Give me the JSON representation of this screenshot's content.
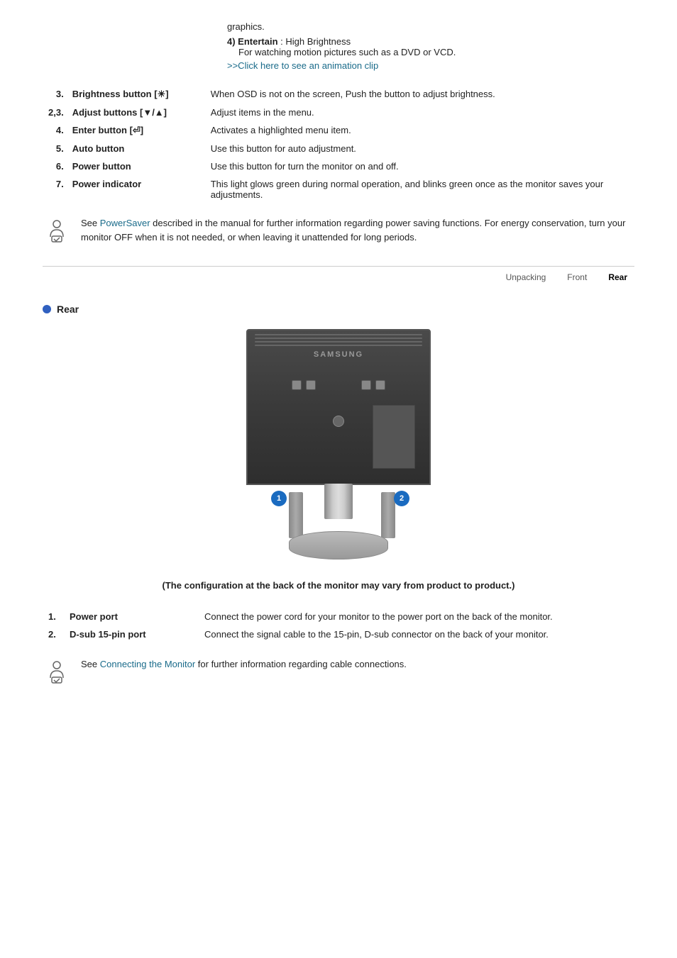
{
  "top": {
    "intro_text": "graphics.",
    "entertain": {
      "label": "4) Entertain",
      "colon": " : High Brightness",
      "sub": "For watching motion pictures such as a DVD or VCD.",
      "link_text": ">>Click here to see an animation clip",
      "link_href": "#"
    }
  },
  "features": [
    {
      "num": "3.",
      "label": "Brightness button [☀]",
      "desc": "When OSD is not on the screen, Push the button to adjust brightness."
    },
    {
      "num": "2,3.",
      "label": "Adjust buttons [▼/▲]",
      "desc": "Adjust items in the menu."
    },
    {
      "num": "4.",
      "label": "Enter button [⏎]",
      "desc": "Activates a highlighted menu item."
    },
    {
      "num": "5.",
      "label": "Auto button",
      "desc": "Use this button for auto adjustment."
    },
    {
      "num": "6.",
      "label": "Power button",
      "desc": "Use this button for turn the monitor on and off."
    },
    {
      "num": "7.",
      "label": "Power indicator",
      "desc": "This light glows green during normal operation, and blinks green once as the monitor saves your adjustments."
    }
  ],
  "note1": {
    "text_before": "See ",
    "link_text": "PowerSaver",
    "link_href": "#",
    "text_after": " described in the manual for further information regarding power saving functions. For energy conservation, turn your monitor OFF when it is not needed, or when leaving it unattended for long periods."
  },
  "nav": {
    "items": [
      {
        "label": "Unpacking",
        "active": false
      },
      {
        "label": "Front",
        "active": false
      },
      {
        "label": "Rear",
        "active": true
      }
    ]
  },
  "rear_section": {
    "title": "Rear",
    "config_note": "(The configuration at the back of the monitor may vary from product to product.)"
  },
  "rear_features": [
    {
      "num": "1.",
      "label": "Power port",
      "desc": "Connect the power cord for your monitor to the power port on the back of the monitor."
    },
    {
      "num": "2.",
      "label": "D-sub 15-pin port",
      "desc": "Connect the signal cable to the 15-pin, D-sub connector on the back of your monitor."
    }
  ],
  "note2": {
    "text_before": "See ",
    "link_text": "Connecting the Monitor",
    "link_href": "#",
    "text_after": " for further information regarding cable connections."
  },
  "badges": {
    "one": "1",
    "two": "2"
  }
}
